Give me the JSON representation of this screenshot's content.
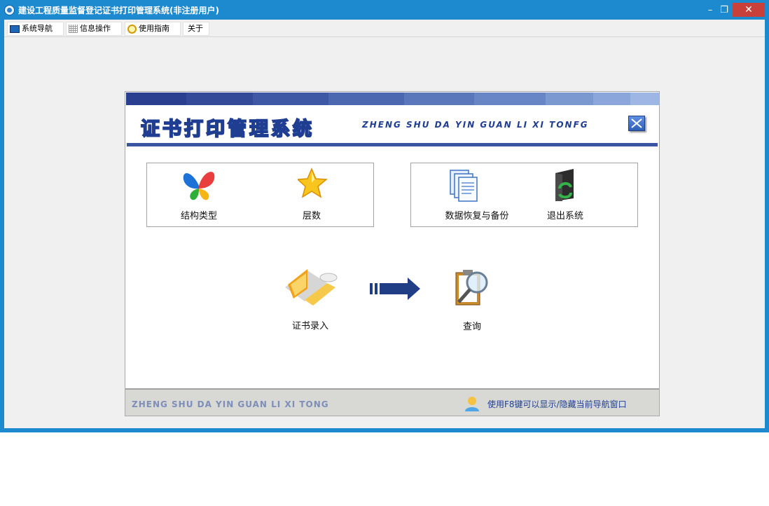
{
  "window": {
    "title": "建设工程质量监督登记证书打印管理系统(非注册用户)",
    "min_label": "–",
    "max_label": "❐",
    "close_label": "✕"
  },
  "menu": [
    {
      "label": "系统导航",
      "icon": "monitor-icon"
    },
    {
      "label": "信息操作",
      "icon": "grid-icon"
    },
    {
      "label": "使用指南",
      "icon": "clock-icon"
    },
    {
      "label": "关于"
    }
  ],
  "banner": {
    "title_cn": "证书打印管理系统",
    "title_en": "ZHENG SHU DA YIN GUAN LI XI TONFG"
  },
  "tools": {
    "structure_type": {
      "label": "结构类型",
      "icon": "butterfly-icon"
    },
    "floors": {
      "label": "层数",
      "icon": "star-icon"
    },
    "backup": {
      "label": "数据恢复与备份",
      "icon": "documents-icon"
    },
    "exit": {
      "label": "退出系统",
      "icon": "exit-icon"
    },
    "cert_entry": {
      "label": "证书录入",
      "icon": "notebook-icon"
    },
    "query": {
      "label": "查询",
      "icon": "magnifier-clipboard-icon"
    }
  },
  "footer": {
    "brand_en": "ZHENG SHU DA YIN GUAN LI XI TONG",
    "tip": "使用F8键可以显示/隐藏当前导航窗口"
  },
  "colors": {
    "titlebar": "#1d8ad0",
    "close_button": "#c9403a",
    "banner_blue": "#1f3e92",
    "arrow": "#1f3e86"
  }
}
